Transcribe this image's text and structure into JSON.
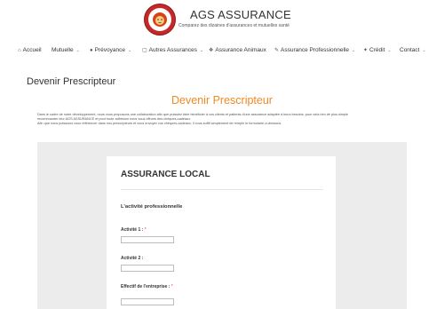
{
  "header": {
    "brand_title": "AGS ASSURANCE",
    "brand_subtitle": "Comparez des dizaines d'assurances et mutuelles santé",
    "logo_icon": "lion-logo-icon",
    "brand_color": "#c62828"
  },
  "nav": {
    "items": [
      {
        "label": "Accueil",
        "icon": "home-icon",
        "has_dropdown": false
      },
      {
        "label": "Mutuelle",
        "icon": "",
        "has_dropdown": true
      },
      {
        "label": "Prévoyance",
        "icon": "person-icon",
        "has_dropdown": true
      },
      {
        "label": "Autres Assurances",
        "icon": "square-icon",
        "has_dropdown": true
      },
      {
        "label": "Assurance Animaux",
        "icon": "paw-icon",
        "has_dropdown": false
      },
      {
        "label": "Assurance Professionnelle",
        "icon": "wrench-icon",
        "has_dropdown": true
      },
      {
        "label": "Crédit",
        "icon": "tag-icon",
        "has_dropdown": true
      },
      {
        "label": "Contact",
        "icon": "",
        "has_dropdown": true
      }
    ]
  },
  "page": {
    "heading": "Devenir Prescripteur",
    "section_title": "Devenir Prescripteur",
    "intro_lines": [
      "Dans le cadre de notre développement, nous vous proposons une collaboration afin que puissiez faire bénéficier à vos clients et patients d'une assurance adaptée à leurs besoins, pour cela rien de plus simple",
      "recommander leur AGS ASSURANCE et pour toute adhésion nous vous offrons des chèques-cadeaux.",
      "Afin que nous puissions vous référencer dans nos prescripteurs et vous envoyer vos chèques-cadeaux, il vous suffit simplement de remplir le formulaire ci-dessous."
    ],
    "accent_color": "#f08a24"
  },
  "form": {
    "title": "ASSURANCE LOCAL",
    "section": "L'activité professionnelle",
    "fields": [
      {
        "label": "Activité 1 :",
        "required_mark": "*",
        "value": ""
      },
      {
        "label": "Activité 2 :",
        "required_mark": "",
        "value": ""
      },
      {
        "label": "Effectif de l'entreprise :",
        "required_mark": "*",
        "value": ""
      }
    ]
  }
}
